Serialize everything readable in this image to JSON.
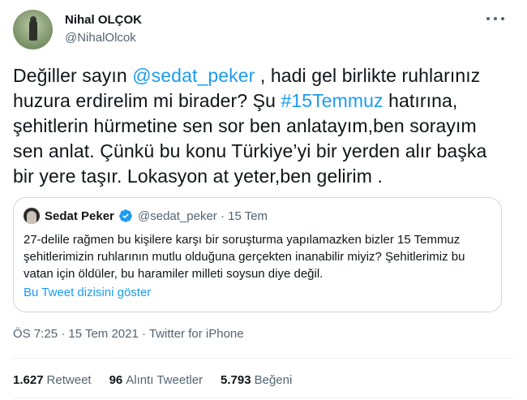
{
  "author": {
    "name": "Nihal OLÇOK",
    "handle": "@NihalOlcok"
  },
  "tweet": {
    "part1": "Değiller sayın ",
    "mention": "@sedat_peker",
    "part2": " , hadi gel birlikte ruhlarınız huzura erdirelim mi birader? Şu ",
    "hashtag": "#15Temmuz",
    "part3": " hatırına, şehitlerin hürmetine sen sor ben anlatayım,ben sorayım sen anlat. Çünkü bu konu Türkiye’yi bir yerden alır başka bir yere taşır. Lokasyon at  yeter,ben gelirim ."
  },
  "quoted": {
    "name": "Sedat Peker",
    "meta": "@sedat_peker · 15 Tem",
    "text": "27-delile rağmen bu kişilere karşı bir soruşturma yapılamazken bizler 15 Temmuz şehitlerimizin ruhlarının mutlu olduğuna gerçekten inanabilir miyiz? Şehitlerimiz bu vatan için öldüler, bu haramiler milleti soysun diye değil.",
    "thread_link": "Bu Tweet dizisini göster"
  },
  "timestamp": "ÖS 7:25 · 15 Tem 2021 · Twitter for iPhone",
  "stats": {
    "retweets_count": "1.627",
    "retweets_label": "Retweet",
    "quotes_count": "96",
    "quotes_label": "Alıntı Tweetler",
    "likes_count": "5.793",
    "likes_label": "Beğeni"
  },
  "colors": {
    "link": "#1d9bf0",
    "secondary_text": "#536471",
    "primary_text": "#0f1419",
    "border": "#cfd9de"
  },
  "icons": [
    "more-options-icon",
    "verified-badge-icon"
  ]
}
